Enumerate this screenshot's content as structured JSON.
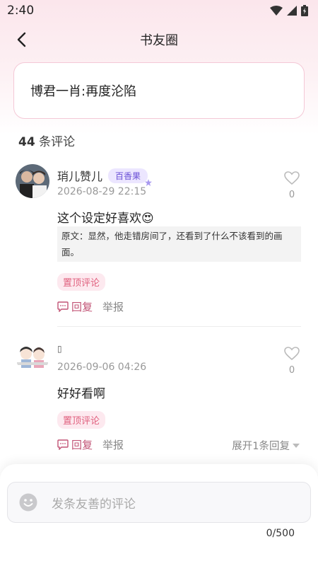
{
  "status_bar": {
    "time": "2:40"
  },
  "nav": {
    "title": "书友圈"
  },
  "book": {
    "title": "博君一肖:再度沦陷"
  },
  "comments_header": {
    "count": "44",
    "label": " 条评论"
  },
  "comments": [
    {
      "username": "琑儿赞儿",
      "badge": "百香果",
      "timestamp": "2026-08-29 22:15",
      "likes": "0",
      "text": "这个设定好喜欢😍",
      "quote": "原文：显然，他走错房间了，还看到了什么不该看到的画面。",
      "pin_label": "置顶评论",
      "reply_label": "回复",
      "report_label": "举报"
    },
    {
      "username": "▯",
      "timestamp": "2026-09-06 04:26",
      "likes": "0",
      "text": "好好看啊",
      "pin_label": "置顶评论",
      "reply_label": "回复",
      "report_label": "举报",
      "expand_label": "展开1条回复"
    }
  ],
  "composer": {
    "placeholder": "发条友善的评论",
    "char_count": "0/500"
  },
  "colors": {
    "accent": "#e0607e",
    "badge_purple": "#6a4fd6",
    "card_border": "#f4c8d6"
  }
}
